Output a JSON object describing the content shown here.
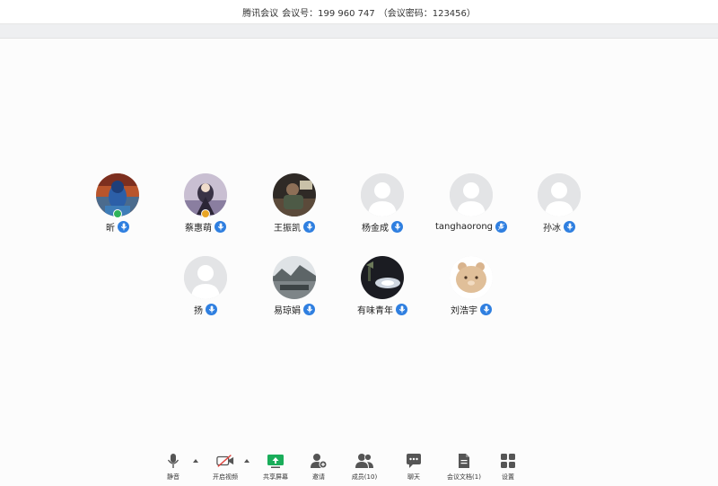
{
  "title_bar": {
    "app_name": "腾讯会议",
    "meeting_id": "会议号：199 960 747",
    "password": "（会议密码：123456）"
  },
  "participants": [
    {
      "name": "昕",
      "avatar": "photo-blue-figure",
      "badge": "host-badge-green"
    },
    {
      "name": "蔡惠萌",
      "avatar": "photo-anime-girl",
      "badge": "cohost-badge-orange"
    },
    {
      "name": "王振凯",
      "avatar": "photo-person-desk"
    },
    {
      "name": "杨金成",
      "avatar": "default-avatar"
    },
    {
      "name": "tanghaorong",
      "avatar": "default-avatar"
    },
    {
      "name": "孙冰",
      "avatar": "default-avatar"
    },
    {
      "name": "扬",
      "avatar": "default-avatar"
    },
    {
      "name": "易琼娟",
      "avatar": "photo-landscape"
    },
    {
      "name": "有味青年",
      "avatar": "photo-night"
    },
    {
      "name": "刘浩宇",
      "avatar": "photo-bear-cartoon"
    }
  ],
  "toolbar": {
    "mute": "静音",
    "video": "开启视频",
    "share": "共享屏幕",
    "invite": "邀请",
    "members": "成员(10)",
    "chat": "聊天",
    "docs": "会议文档(1)",
    "settings": "设置"
  },
  "colors": {
    "mic_badge": "#2f7fe0",
    "host_badge": "#2fb35a",
    "cohost_badge": "#e8a526",
    "default_avatar_bg": "#e3e4e6",
    "default_avatar_fg": "#ffffff",
    "share_green": "#1aad5a",
    "video_off_red": "#e0433d"
  }
}
